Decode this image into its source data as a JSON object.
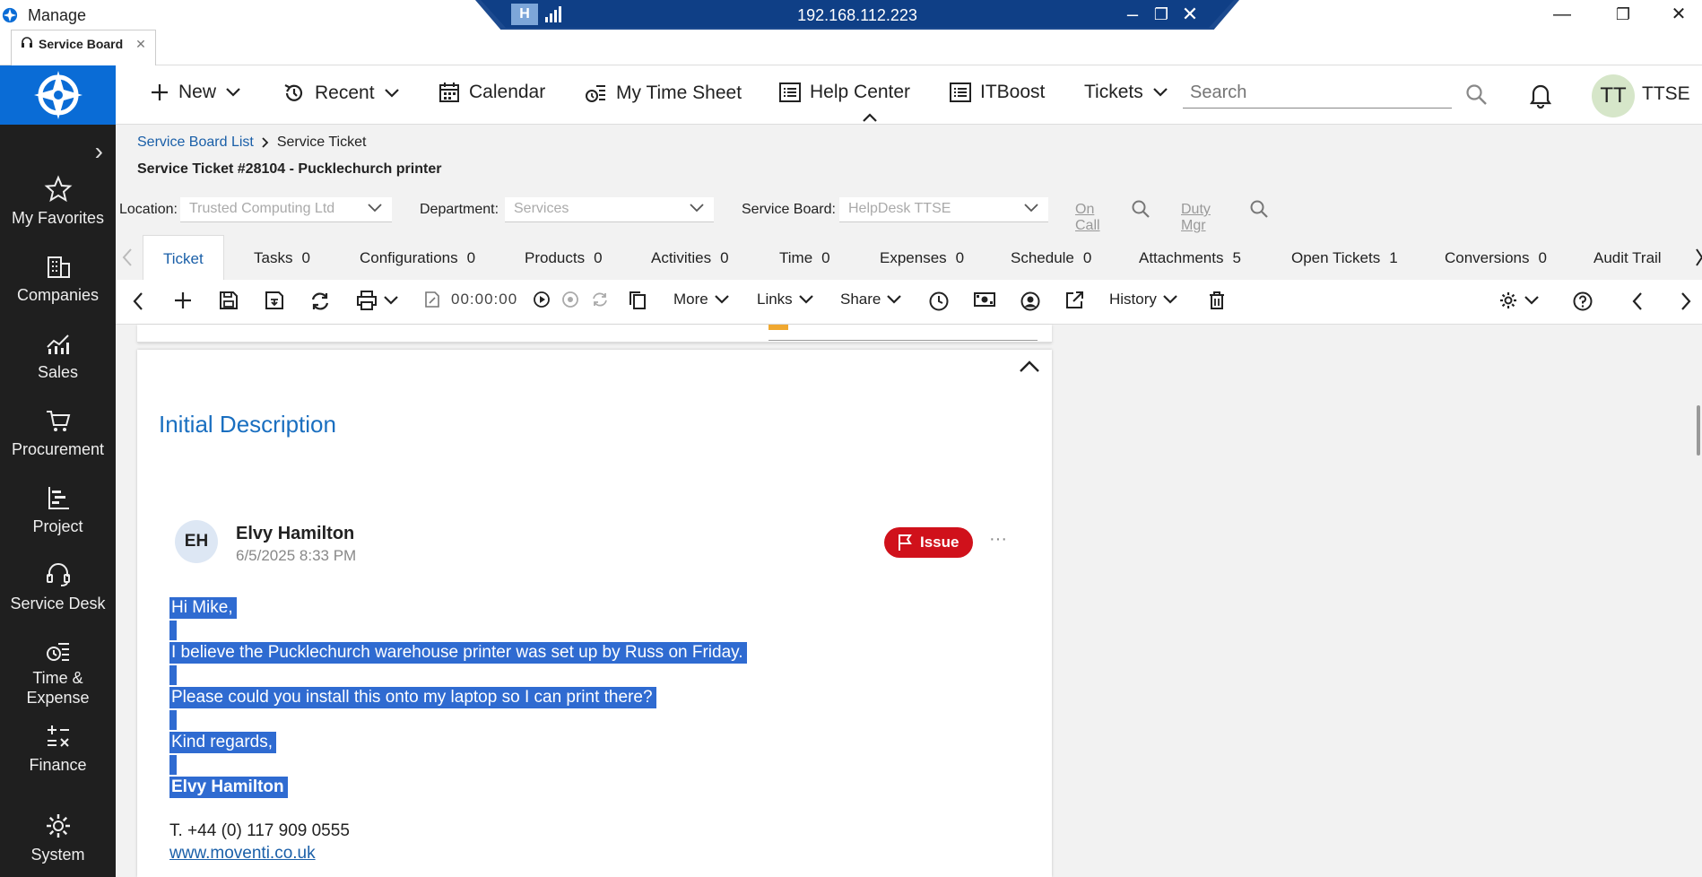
{
  "window": {
    "app_title": "Manage",
    "remote_ip": "192.168.112.223",
    "remote_badge": "H",
    "browser_tab": "Service Board"
  },
  "brand": {
    "accent": "#0a6cd6",
    "issue_red": "#d0111b",
    "selection_blue": "#2f6bd1"
  },
  "leftnav": {
    "items": [
      {
        "label": "My Favorites",
        "icon": "star-icon"
      },
      {
        "label": "Companies",
        "icon": "building-icon"
      },
      {
        "label": "Sales",
        "icon": "chart-icon"
      },
      {
        "label": "Procurement",
        "icon": "cart-icon"
      },
      {
        "label": "Project",
        "icon": "project-icon"
      },
      {
        "label": "Service Desk",
        "icon": "headset-icon"
      },
      {
        "label": "Time &",
        "label2": "Expense",
        "icon": "time-expense-icon"
      },
      {
        "label": "Finance",
        "icon": "calculator-icon"
      },
      {
        "label": "System",
        "icon": "gear-icon"
      }
    ]
  },
  "topbar": {
    "new": "New",
    "recent": "Recent",
    "calendar": "Calendar",
    "timesheet": "My Time Sheet",
    "help": "Help Center",
    "itboost": "ITBoost",
    "tickets": "Tickets",
    "search_placeholder": "Search",
    "avatar_initials": "TT",
    "user": "TTSE"
  },
  "breadcrumb": {
    "parent": "Service Board List",
    "current": "Service Ticket"
  },
  "ticket_title": "Service Ticket #28104 - Pucklechurch printer",
  "filters": {
    "location_label": "Location:",
    "location_value": "Trusted Computing Ltd",
    "department_label": "Department:",
    "department_value": "Services",
    "board_label": "Service Board:",
    "board_value": "HelpDesk TTSE",
    "on_call": "On Call",
    "duty_mgr": "Duty Mgr"
  },
  "tabs": [
    {
      "label": "Ticket",
      "count": ""
    },
    {
      "label": "Tasks",
      "count": "0"
    },
    {
      "label": "Configurations",
      "count": "0"
    },
    {
      "label": "Products",
      "count": "0"
    },
    {
      "label": "Activities",
      "count": "0"
    },
    {
      "label": "Time",
      "count": "0"
    },
    {
      "label": "Expenses",
      "count": "0"
    },
    {
      "label": "Schedule",
      "count": "0"
    },
    {
      "label": "Attachments",
      "count": "5"
    },
    {
      "label": "Open Tickets",
      "count": "1"
    },
    {
      "label": "Conversions",
      "count": "0"
    },
    {
      "label": "Audit Trail",
      "count": ""
    }
  ],
  "toolbar": {
    "timer": "00:00:00",
    "more": "More",
    "links": "Links",
    "share": "Share",
    "history": "History"
  },
  "description": {
    "title": "Initial Description",
    "author_initials": "EH",
    "author_name": "Elvy Hamilton",
    "date": "6/5/2025 8:33 PM",
    "badge": "Issue",
    "lines": [
      "Hi Mike,",
      "I believe the Pucklechurch warehouse printer was set up by Russ on Friday.",
      "Please could you install this onto my laptop so I can print there?",
      "Kind regards,",
      "Elvy Hamilton"
    ],
    "phone": "T. +44 (0) 117 909 0555",
    "website": "www.moventi.co.uk"
  }
}
